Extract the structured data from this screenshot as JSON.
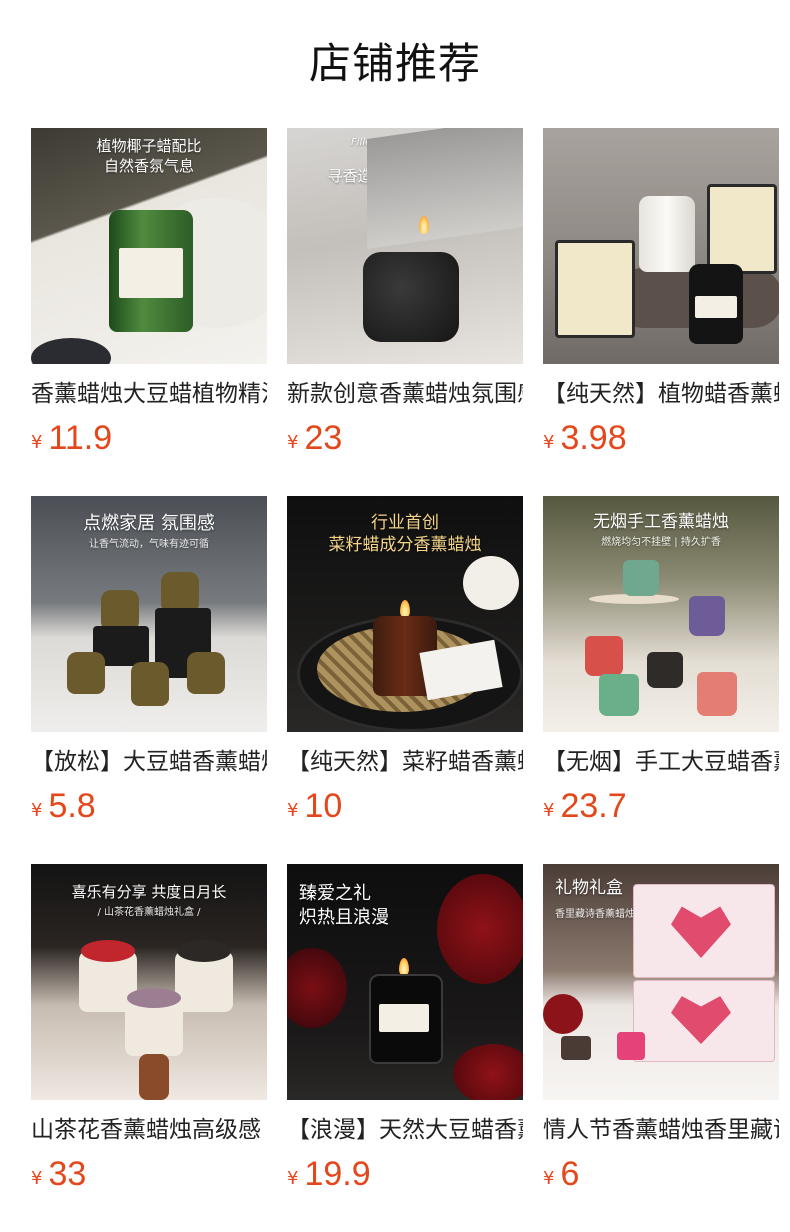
{
  "header": {
    "title": "店铺推荐"
  },
  "currency": "¥",
  "products": [
    {
      "title": "香薰蜡烛大豆蜡植物精油",
      "price": "11.9",
      "overlay": [
        "植物椰子蜡配比\n自然香氛气息",
        ""
      ]
    },
    {
      "title": "新款创意香薰蜡烛氛围感",
      "price": "23",
      "overlay": [
        "Filled with sweet love",
        "寻香造梦 弥漫沁甜爱意"
      ]
    },
    {
      "title": "【纯天然】植物蜡香薰蜡烛",
      "price": "3.98",
      "overlay": [
        "",
        ""
      ]
    },
    {
      "title": "【放松】大豆蜡香薰蜡烛",
      "price": "5.8",
      "overlay": [
        "点燃家居 氛围感",
        "让香气流动，气味有迹可循"
      ]
    },
    {
      "title": "【纯天然】菜籽蜡香薰蜡烛",
      "price": "10",
      "overlay": [
        "行业首创\n菜籽蜡成分香薰蜡烛",
        ""
      ]
    },
    {
      "title": "【无烟】手工大豆蜡香薰",
      "price": "23.7",
      "overlay": [
        "无烟手工香薰蜡烛",
        "燃烧均匀不挂壁 | 持久扩香"
      ]
    },
    {
      "title": "山茶花香薰蜡烛高级感",
      "price": "33",
      "overlay": [
        "喜乐有分享 共度日月长",
        "/ 山茶花香薰蜡烛礼盒 /"
      ]
    },
    {
      "title": "【浪漫】天然大豆蜡香薰",
      "price": "19.9",
      "overlay": [
        "臻爱之礼\n炽热且浪漫",
        ""
      ]
    },
    {
      "title": "情人节香薰蜡烛香里藏诗",
      "price": "6",
      "overlay": [
        "礼物礼盒",
        "香里藏诗香薰蜡烛"
      ]
    }
  ],
  "colors": {
    "price": "#e4471b",
    "title": "#222222"
  }
}
